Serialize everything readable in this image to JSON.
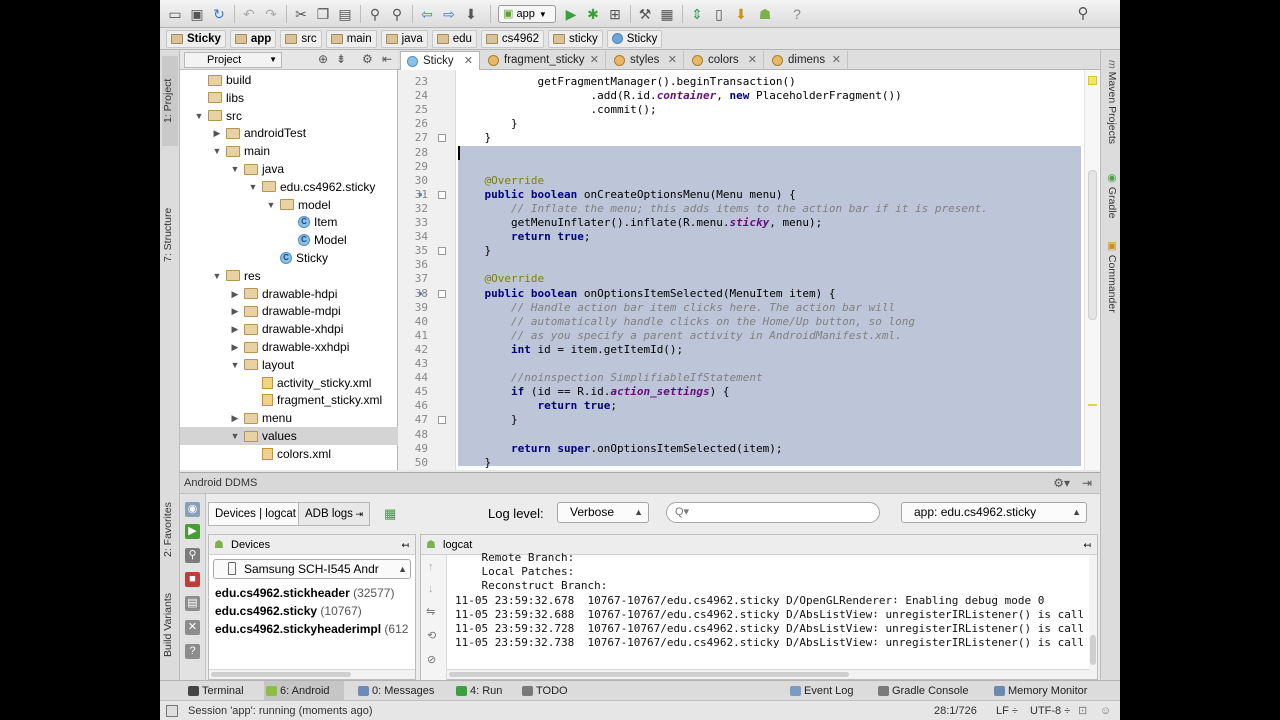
{
  "toolbar": {
    "run_config": "app"
  },
  "breadcrumb": [
    "Sticky",
    "app",
    "src",
    "main",
    "java",
    "edu",
    "cs4962",
    "sticky",
    "Sticky"
  ],
  "left_stripe": {
    "project": "1: Project",
    "structure": "7: Structure",
    "favorites": "2: Favorites",
    "build_variants": "Build Variants"
  },
  "right_stripe": {
    "maven": "Maven Projects",
    "gradle": "Gradle",
    "commander": "Commander"
  },
  "project": {
    "selector": "Project",
    "tree": [
      {
        "label": "build",
        "depth": 0,
        "type": "folder",
        "arrow": "none"
      },
      {
        "label": "libs",
        "depth": 0,
        "type": "folder",
        "arrow": "none"
      },
      {
        "label": "src",
        "depth": 0,
        "type": "folder",
        "arrow": "open"
      },
      {
        "label": "androidTest",
        "depth": 1,
        "type": "folder",
        "arrow": "closed"
      },
      {
        "label": "main",
        "depth": 1,
        "type": "folder",
        "arrow": "open"
      },
      {
        "label": "java",
        "depth": 2,
        "type": "folder",
        "arrow": "open"
      },
      {
        "label": "edu.cs4962.sticky",
        "depth": 3,
        "type": "folder",
        "arrow": "open"
      },
      {
        "label": "model",
        "depth": 4,
        "type": "folder",
        "arrow": "open"
      },
      {
        "label": "Item",
        "depth": 5,
        "type": "class",
        "arrow": "none"
      },
      {
        "label": "Model",
        "depth": 5,
        "type": "class",
        "arrow": "none"
      },
      {
        "label": "Sticky",
        "depth": 4,
        "type": "class",
        "arrow": "none"
      },
      {
        "label": "res",
        "depth": 1,
        "type": "folder",
        "arrow": "open"
      },
      {
        "label": "drawable-hdpi",
        "depth": 2,
        "type": "folder",
        "arrow": "closed"
      },
      {
        "label": "drawable-mdpi",
        "depth": 2,
        "type": "folder",
        "arrow": "closed"
      },
      {
        "label": "drawable-xhdpi",
        "depth": 2,
        "type": "folder",
        "arrow": "closed"
      },
      {
        "label": "drawable-xxhdpi",
        "depth": 2,
        "type": "folder",
        "arrow": "closed"
      },
      {
        "label": "layout",
        "depth": 2,
        "type": "folder",
        "arrow": "open"
      },
      {
        "label": "activity_sticky.xml",
        "depth": 3,
        "type": "xml",
        "arrow": "none"
      },
      {
        "label": "fragment_sticky.xml",
        "depth": 3,
        "type": "xml",
        "arrow": "none"
      },
      {
        "label": "menu",
        "depth": 2,
        "type": "folder",
        "arrow": "closed"
      },
      {
        "label": "values",
        "depth": 2,
        "type": "folder",
        "arrow": "open",
        "selected": true
      },
      {
        "label": "colors.xml",
        "depth": 3,
        "type": "xml",
        "arrow": "none"
      }
    ]
  },
  "tabs": [
    {
      "label": "Sticky",
      "icon": "class",
      "active": true
    },
    {
      "label": "fragment_sticky",
      "icon": "xml"
    },
    {
      "label": "styles",
      "icon": "xml"
    },
    {
      "label": "colors",
      "icon": "xml"
    },
    {
      "label": "dimens",
      "icon": "xml"
    }
  ],
  "editor": {
    "lines": [
      {
        "n": "23",
        "html": "            getFragmentManager().beginTransaction()"
      },
      {
        "n": "24",
        "html": "                    .add(R.id.<span class='fd'>container</span>, <span class='kw'>new</span> PlaceholderFragment())"
      },
      {
        "n": "25",
        "html": "                    .commit();"
      },
      {
        "n": "26",
        "html": "        }"
      },
      {
        "n": "27",
        "html": "    }"
      },
      {
        "n": "28",
        "html": ""
      },
      {
        "n": "29",
        "html": ""
      },
      {
        "n": "30",
        "html": "    <span class='an'>@Override</span>"
      },
      {
        "n": "31",
        "html": "    <span class='kw'>public boolean</span> onCreateOptionsMenu(Menu menu) {"
      },
      {
        "n": "32",
        "html": "        <span class='cm'>// Inflate the menu; this adds items to the action bar if it is present.</span>"
      },
      {
        "n": "33",
        "html": "        getMenuInflater().inflate(R.menu.<span class='fd'>sticky</span>, menu);"
      },
      {
        "n": "34",
        "html": "        <span class='kw'>return true</span>;"
      },
      {
        "n": "35",
        "html": "    }"
      },
      {
        "n": "36",
        "html": ""
      },
      {
        "n": "37",
        "html": "    <span class='an'>@Override</span>"
      },
      {
        "n": "38",
        "html": "    <span class='kw'>public boolean</span> onOptionsItemSelected(MenuItem item) {"
      },
      {
        "n": "39",
        "html": "        <span class='cm'>// Handle action bar item clicks here. The action bar will</span>"
      },
      {
        "n": "40",
        "html": "        <span class='cm'>// automatically handle clicks on the Home/Up button, so long</span>"
      },
      {
        "n": "41",
        "html": "        <span class='cm'>// as you specify a parent activity in AndroidManifest.xml.</span>"
      },
      {
        "n": "42",
        "html": "        <span class='kw'>int</span> id = item.getItemId();"
      },
      {
        "n": "43",
        "html": ""
      },
      {
        "n": "44",
        "html": "        <span class='cm'>//noinspection SimplifiableIfStatement</span>"
      },
      {
        "n": "45",
        "html": "        <span class='kw'>if</span> (id == R.id.<span class='fd'>action_settings</span>) {"
      },
      {
        "n": "46",
        "html": "            <span class='kw'>return true</span>;"
      },
      {
        "n": "47",
        "html": "        }"
      },
      {
        "n": "48",
        "html": ""
      },
      {
        "n": "49",
        "html": "        <span class='kw'>return super</span>.onOptionsItemSelected(item);"
      },
      {
        "n": "50",
        "html": "    }"
      }
    ]
  },
  "ddms": {
    "title": "Android DDMS",
    "tabs": [
      "Devices | logcat",
      "ADB logs"
    ],
    "log_level_label": "Log level:",
    "log_level": "Verbose",
    "search_placeholder": "Q▾",
    "app_filter": "app: edu.cs4962.sticky",
    "devices_title": "Devices",
    "device": "Samsung SCH-I545 Andr",
    "processes": [
      {
        "name": "edu.cs4962.stickheader",
        "pid": "(32577)"
      },
      {
        "name": "edu.cs4962.sticky",
        "pid": "(10767)"
      },
      {
        "name": "edu.cs4962.stickyheaderimpl",
        "pid": "(612"
      }
    ],
    "logcat_title": "logcat",
    "log_lines": [
      "    Remote Branch:",
      "    Local Patches:",
      "    Reconstruct Branch:",
      "11-05 23:59:32.678  10767-10767/edu.cs4962.sticky D/OpenGLRenderer∶ Enabling debug mode 0",
      "11-05 23:59:32.688  10767-10767/edu.cs4962.sticky D/AbsListView∶ unregisterIRListener() is call",
      "11-05 23:59:32.728  10767-10767/edu.cs4962.sticky D/AbsListView∶ unregisterIRListener() is call",
      "11-05 23:59:32.738  10767-10767/edu.cs4962.sticky D/AbsListView∶ unregisterIRListener() is call"
    ]
  },
  "bottom_tools": {
    "terminal": "Terminal",
    "android": "6: Android",
    "messages": "0: Messages",
    "run": "4: Run",
    "todo": "TODO",
    "event_log": "Event Log",
    "gradle_console": "Gradle Console",
    "memory_monitor": "Memory Monitor"
  },
  "status": {
    "text": "Session 'app': running (moments ago)",
    "position": "28:1/726",
    "line_sep": "LF ÷",
    "encoding": "UTF-8 ÷"
  }
}
